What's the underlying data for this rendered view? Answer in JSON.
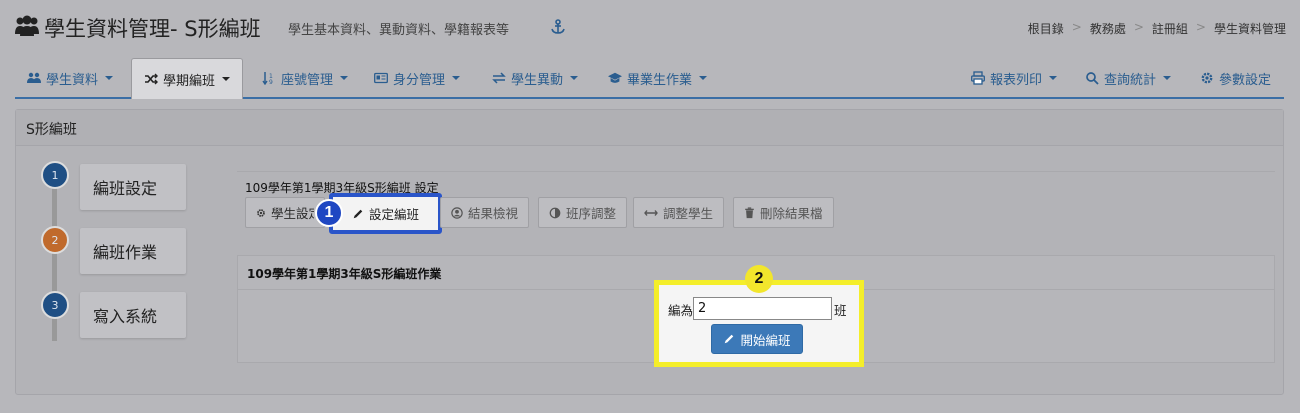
{
  "header": {
    "title": "學生資料管理- S形編班",
    "subtitle": "學生基本資料、異動資料、學籍報表等",
    "breadcrumb": [
      "根目錄",
      "教務處",
      "註冊組",
      "學生資料管理"
    ]
  },
  "nav": {
    "left": [
      {
        "label": "學生資料",
        "icon": "users-icon"
      },
      {
        "label": "學期編班",
        "icon": "shuffle-icon"
      },
      {
        "label": "座號管理",
        "icon": "sort-numeric-icon"
      },
      {
        "label": "身分管理",
        "icon": "id-card-icon"
      },
      {
        "label": "學生異動",
        "icon": "exchange-icon"
      },
      {
        "label": "畢業生作業",
        "icon": "graduation-cap-icon"
      }
    ],
    "right": [
      {
        "label": "報表列印",
        "icon": "print-icon"
      },
      {
        "label": "查詢統計",
        "icon": "search-icon"
      },
      {
        "label": "參數設定",
        "icon": "gear-icon"
      }
    ],
    "active_index": 1
  },
  "panel": {
    "title": "S形編班",
    "steps": [
      {
        "num": "1",
        "label": "編班設定",
        "color": "#1f4f84"
      },
      {
        "num": "2",
        "label": "編班作業",
        "color": "#c06a2c"
      },
      {
        "num": "3",
        "label": "寫入系統",
        "color": "#1f4f84"
      }
    ]
  },
  "setup": {
    "title": "109學年第1學期3年級S形編班 設定",
    "buttons": [
      "學生設定",
      "設定編班",
      "結果檢視",
      "班序調整",
      "調整學生",
      "刪除結果檔"
    ]
  },
  "work": {
    "title": "109學年第1學期3年級S形編班作業",
    "label": "編為",
    "input_value": "2",
    "suffix": "班",
    "start_label": "開始編班"
  },
  "annotations": {
    "badge1": "1",
    "badge2": "2",
    "highlight1_color": "#2a55c9",
    "highlight2_color": "#f4ee2a"
  }
}
